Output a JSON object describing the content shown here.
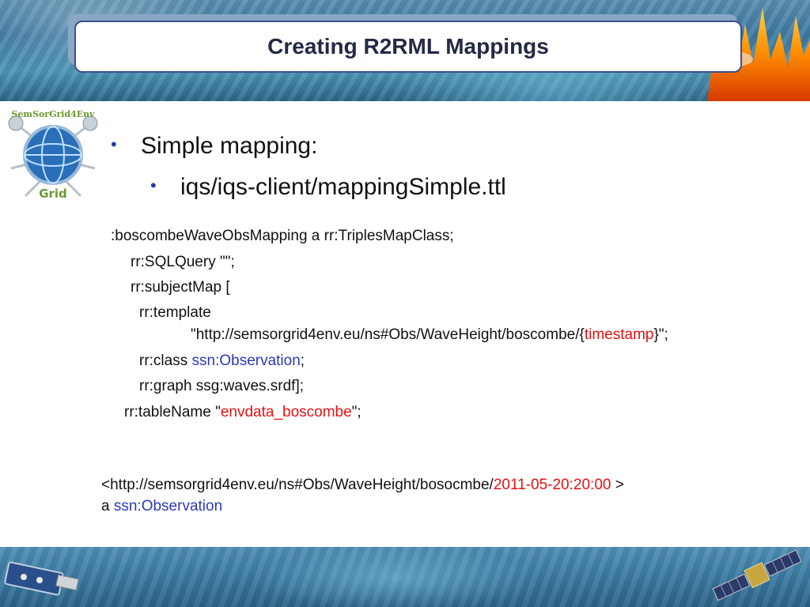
{
  "slide": {
    "title": "Creating R2RML Mappings",
    "bullets": [
      {
        "symbol": "•",
        "text": "Simple mapping:"
      },
      {
        "symbol": "•",
        "text": "iqs/iqs-client/mappingSimple.ttl"
      }
    ],
    "code": {
      "line1": ":boscombeWaveObsMapping   a rr:TriplesMapClass;",
      "line2": "rr:SQLQuery \"\";",
      "line3": "rr:subjectMap [",
      "line4": "rr:template",
      "line5_pre": "\"http://semsorgrid4env.eu/ns#Obs/WaveHeight/boscombe/{",
      "line5_red": "timestamp",
      "line5_post": "}\";",
      "line6_pre": "rr:class ",
      "line6_blue": "ssn:Observation",
      "line6_post": ";",
      "line7": "rr:graph ssg:waves.srdf];",
      "line8_pre": "rr:tableName \"",
      "line8_red": "envdata_boscombe",
      "line8_post": "\";"
    },
    "result": {
      "line1_pre": "<http://semsorgrid4env.eu/ns#Obs/WaveHeight/bosocmbe/",
      "line1_red": "2011-05-20:20:00",
      "line1_post": " >",
      "line2_pre": "a  ",
      "line2_blue": "ssn:Observation"
    },
    "logo": {
      "top_text": "SemSorGrid4Env",
      "bottom_text": "Grid"
    },
    "colors": {
      "accent_red": "#e81010",
      "accent_blue": "#2c39b8",
      "title_border": "#3d4f8f"
    }
  }
}
